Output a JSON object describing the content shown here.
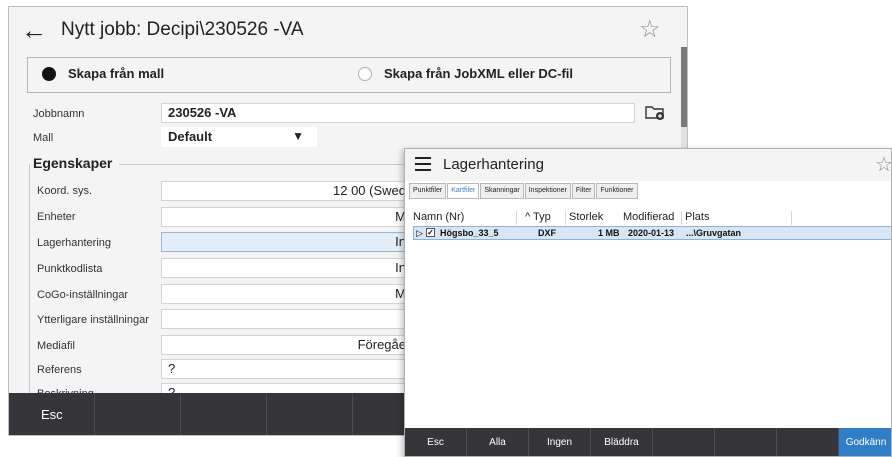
{
  "job_window": {
    "title": "Nytt jobb:  Decipi\\230526 -VA",
    "back_icon": "arrow-left-icon",
    "star_icon": "star-outline-icon",
    "radio_options": [
      {
        "label": "Skapa från mall",
        "selected": true
      },
      {
        "label": "Skapa från JobXML eller DC-fil",
        "selected": false
      }
    ],
    "fields": {
      "jobbnamn_label": "Jobbnamn",
      "jobbnamn_value": "230526 -VA",
      "mall_label": "Mall",
      "mall_value": "Default"
    },
    "group_title": "Egenskaper",
    "properties": [
      {
        "label": "Koord. sys.",
        "value": "12 00 (Swed"
      },
      {
        "label": "Enheter",
        "value": "M"
      },
      {
        "label": "Lagerhantering",
        "value": "In"
      },
      {
        "label": "Punktkodlista",
        "value": "In"
      },
      {
        "label": "CoGo-inställningar",
        "value": "M"
      },
      {
        "label": "Ytterligare inställningar",
        "value": ""
      },
      {
        "label": "Mediafil",
        "value": "Föregåe"
      },
      {
        "label": "Referens",
        "value": "?"
      },
      {
        "label": "Beskrivning",
        "value": "?"
      }
    ],
    "bottom_buttons": [
      "Esc",
      "",
      "",
      "",
      ""
    ]
  },
  "lager_window": {
    "title": "Lagerhantering",
    "menu_icon": "hamburger-menu-icon",
    "star_icon": "star-outline-icon",
    "tabs": [
      {
        "label": "Punktfiler",
        "active": false
      },
      {
        "label": "Kartfiler",
        "active": true
      },
      {
        "label": "Skanningar",
        "active": false
      },
      {
        "label": "Inspektioner",
        "active": false
      },
      {
        "label": "Filter",
        "active": false
      },
      {
        "label": "Funktioner",
        "active": false
      }
    ],
    "columns": [
      "Namn (Nr)",
      "^ Typ",
      "Storlek",
      "Modifierad",
      "Plats"
    ],
    "rows": [
      {
        "expander": "▷",
        "checked": true,
        "name": "Högsbo_33_5",
        "type": "DXF",
        "size": "1 MB",
        "modified": "2020-01-13",
        "location": "...\\Gruvgatan"
      }
    ],
    "bottom_buttons": [
      "Esc",
      "Alla",
      "Ingen",
      "Bläddra",
      "",
      "",
      "",
      "Godkänn"
    ]
  }
}
